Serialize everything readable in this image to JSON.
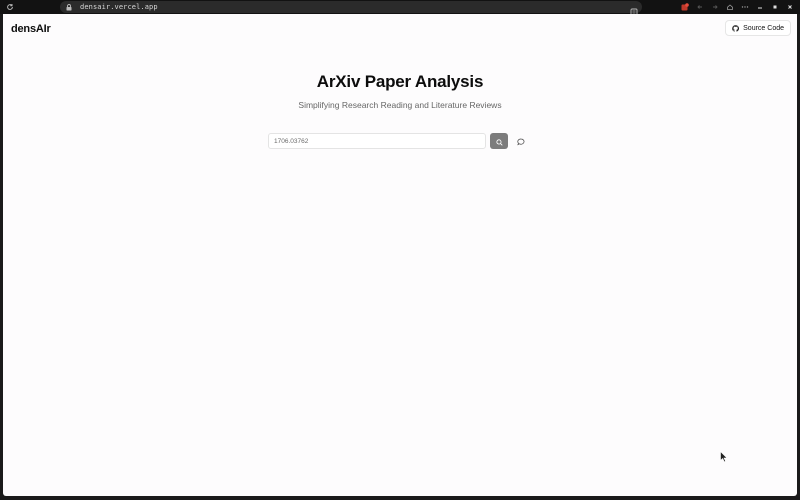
{
  "browser": {
    "url": "densair.vercel.app",
    "icons": [
      "reload-icon",
      "lock-icon",
      "reader-icon",
      "extension-icon",
      "back-icon",
      "forward-icon",
      "home-icon",
      "menu-icon",
      "minimize-icon",
      "maximize-icon",
      "close-icon"
    ]
  },
  "header": {
    "brand": "densAIr",
    "source_button_label": "Source Code",
    "source_icon": "github-icon"
  },
  "hero": {
    "title": "ArXiv Paper Analysis",
    "subtitle": "Simplifying Research Reading and Literature Reviews"
  },
  "search": {
    "value": "1706.03762",
    "search_icon": "search-icon",
    "chat_icon": "chat-icon"
  },
  "colors": {
    "page_bg": "#fdfcfd",
    "search_button": "#7c7c7c",
    "chrome_bg": "#121212"
  }
}
